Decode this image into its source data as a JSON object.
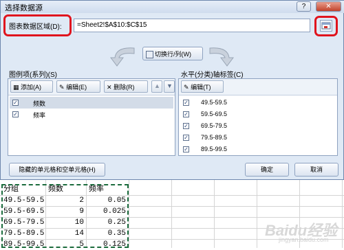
{
  "dialog": {
    "title": "选择数据源",
    "help": "?",
    "close": "✕",
    "range_label": "图表数据区域(D):",
    "range_value": "=Sheet2!$A$10:$C$15",
    "switch_label": "切换行/列(W)",
    "legend_label": "图例项(系列)(S)",
    "axis_label": "水平(分类)轴标签(C)",
    "legend_toolbar": {
      "add": "添加(A)",
      "edit": "编辑(E)",
      "delete": "删除(R)"
    },
    "axis_toolbar": {
      "edit": "编辑(T)"
    },
    "series": [
      {
        "name": "频数",
        "checked": true
      },
      {
        "name": "频率",
        "checked": true
      }
    ],
    "categories": [
      "49.5-59.5",
      "59.5-69.5",
      "69.5-79.5",
      "79.5-89.5",
      "89.5-99.5"
    ],
    "hidden_button": "隐藏的单元格和空单元格(H)",
    "ok": "确定",
    "cancel": "取消"
  },
  "sheet": {
    "headers": [
      "分组",
      "频数",
      "频率"
    ],
    "rows": [
      [
        "49.5-59.5",
        "2",
        "0.05"
      ],
      [
        "59.5-69.5",
        "9",
        "0.025"
      ],
      [
        "69.5-79.5",
        "10",
        "0.25"
      ],
      [
        "79.5-89.5",
        "14",
        "0.35"
      ],
      [
        "89.5-99.5",
        "5",
        "0.125"
      ]
    ]
  },
  "watermark": {
    "main": "Baidu经验",
    "sub": "jingyan.baidu.com"
  },
  "colors": {
    "highlight": "#e0141e",
    "marquee": "#1a6b3c",
    "dialog_bg": "#dfe9f5"
  }
}
